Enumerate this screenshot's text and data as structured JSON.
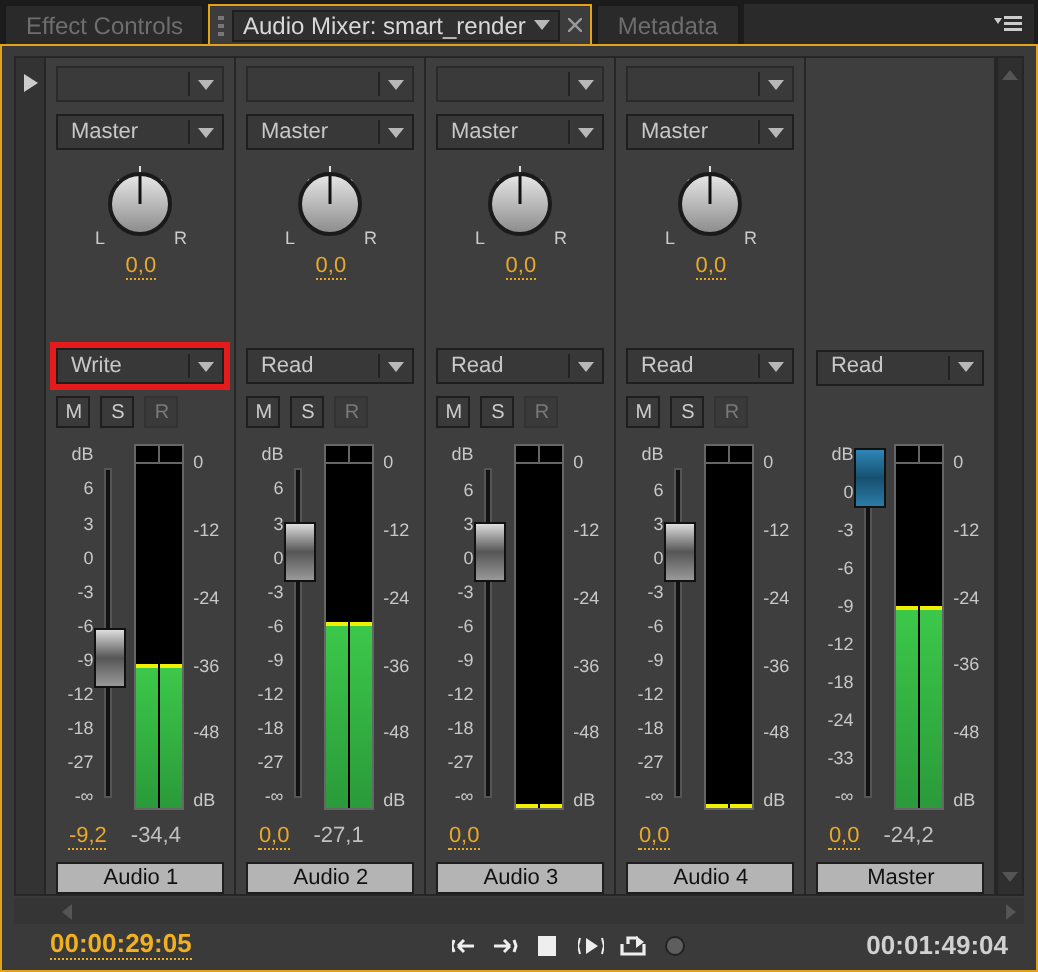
{
  "tabs": [
    {
      "label": "Effect Controls",
      "selected": false
    },
    {
      "label": "Audio Mixer: smart_render",
      "selected": true
    },
    {
      "label": "Metadata",
      "selected": false
    }
  ],
  "channels": [
    {
      "kind": "track",
      "send_disabled": true,
      "output": "Master",
      "pan_left": "L",
      "pan_right": "R",
      "pan_value": "0,0",
      "automation": "Write",
      "highlighted": true,
      "buttons": [
        {
          "label": "M",
          "disabled": false
        },
        {
          "label": "S",
          "disabled": false
        },
        {
          "label": "R",
          "disabled": true
        }
      ],
      "fader_scale": [
        "dB",
        "6",
        "3",
        "0",
        "-3",
        "-6",
        "-9",
        "-12",
        "-18",
        "-27",
        "-∞"
      ],
      "fader": {
        "level": 0.41
      },
      "meter": {
        "level": 0.42
      },
      "meter_scale": [
        "0",
        "-12",
        "-24",
        "-36",
        "-48",
        "dB"
      ],
      "fader_value": "-9,2",
      "peak_value": "-34,4",
      "name": "Audio 1"
    },
    {
      "kind": "track",
      "send_disabled": true,
      "output": "Master",
      "pan_left": "L",
      "pan_right": "R",
      "pan_value": "0,0",
      "automation": "Read",
      "highlighted": false,
      "buttons": [
        {
          "label": "M",
          "disabled": false
        },
        {
          "label": "S",
          "disabled": false
        },
        {
          "label": "R",
          "disabled": true
        }
      ],
      "fader_scale": [
        "dB",
        "6",
        "3",
        "0",
        "-3",
        "-6",
        "-9",
        "-12",
        "-18",
        "-27",
        "-∞"
      ],
      "fader": {
        "level": 0.76
      },
      "meter": {
        "level": 0.54
      },
      "meter_scale": [
        "0",
        "-12",
        "-24",
        "-36",
        "-48",
        "dB"
      ],
      "fader_value": "0,0",
      "peak_value": "-27,1",
      "name": "Audio 2"
    },
    {
      "kind": "track",
      "send_disabled": true,
      "output": "Master",
      "pan_left": "L",
      "pan_right": "R",
      "pan_value": "0,0",
      "automation": "Read",
      "highlighted": false,
      "buttons": [
        {
          "label": "M",
          "disabled": false
        },
        {
          "label": "S",
          "disabled": false
        },
        {
          "label": "R",
          "disabled": true
        }
      ],
      "fader_scale": [
        "dB",
        "6",
        "3",
        "0",
        "-3",
        "-6",
        "-9",
        "-12",
        "-18",
        "-27",
        "-∞"
      ],
      "fader": {
        "level": 0.76
      },
      "meter": {
        "level": 0
      },
      "meter_scale": [
        "0",
        "-12",
        "-24",
        "-36",
        "-48",
        "dB"
      ],
      "fader_value": "0,0",
      "name": "Audio 3"
    },
    {
      "kind": "track",
      "send_disabled": true,
      "output": "Master",
      "pan_left": "L",
      "pan_right": "R",
      "pan_value": "0,0",
      "automation": "Read",
      "highlighted": false,
      "buttons": [
        {
          "label": "M",
          "disabled": false
        },
        {
          "label": "S",
          "disabled": false
        },
        {
          "label": "R",
          "disabled": true
        }
      ],
      "fader_scale": [
        "dB",
        "6",
        "3",
        "0",
        "-3",
        "-6",
        "-9",
        "-12",
        "-18",
        "-27",
        "-∞"
      ],
      "fader": {
        "level": 0.76
      },
      "meter": {
        "level": 0
      },
      "meter_scale": [
        "0",
        "-12",
        "-24",
        "-36",
        "-48",
        "dB"
      ],
      "fader_value": "0,0",
      "name": "Audio 4"
    },
    {
      "kind": "master",
      "automation": "Read",
      "highlighted": false,
      "fader_scale": [
        "dB",
        "0",
        "-3",
        "-6",
        "-9",
        "-12",
        "-18",
        "-24",
        "-33",
        "-∞"
      ],
      "fader": {
        "level": 1
      },
      "meter": {
        "level": 0.59
      },
      "meter_scale": [
        "0",
        "-12",
        "-24",
        "-36",
        "-48",
        "dB"
      ],
      "fader_value": "0,0",
      "peak_value": "-24,2",
      "name": "Master"
    }
  ],
  "transport": {
    "current_time": "00:00:29:05",
    "duration": "00:01:49:04",
    "buttons": [
      {
        "kind": "go-in",
        "disabled": false
      },
      {
        "kind": "go-out",
        "disabled": false
      },
      {
        "kind": "stop",
        "disabled": false
      },
      {
        "kind": "play-in-out",
        "disabled": false
      },
      {
        "kind": "loop",
        "disabled": false
      },
      {
        "kind": "record",
        "disabled": true
      }
    ]
  }
}
